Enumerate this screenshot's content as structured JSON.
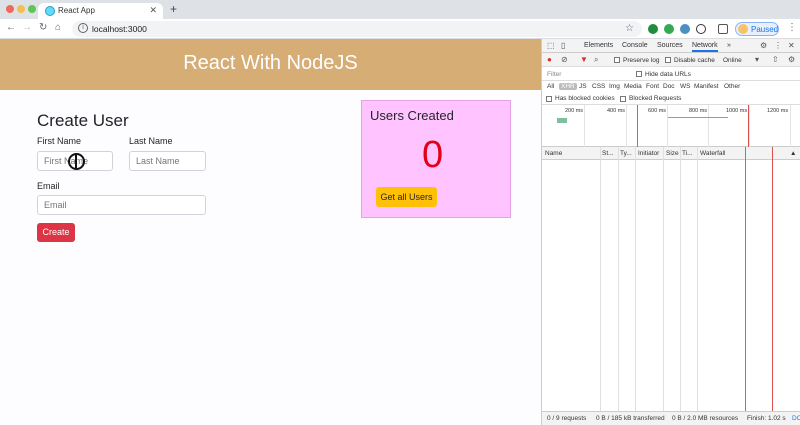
{
  "browser": {
    "tab_title": "React App",
    "url": "localhost:3000",
    "profile_label": "Paused"
  },
  "page": {
    "banner_title": "React With NodeJS",
    "form": {
      "title": "Create User",
      "first_name_label": "First Name",
      "first_name_placeholder": "First Name",
      "last_name_label": "Last Name",
      "last_name_placeholder": "Last Name",
      "email_label": "Email",
      "email_placeholder": "Email",
      "create_button": "Create"
    },
    "users_card": {
      "title": "Users Created",
      "count": "0",
      "get_all_button": "Get all Users"
    }
  },
  "devtools": {
    "tabs": [
      "Elements",
      "Console",
      "Sources",
      "Network"
    ],
    "active_tab": "Network",
    "more_tabs": "»",
    "preserve_log": "Preserve log",
    "disable_cache": "Disable cache",
    "throttle": "Online",
    "filter_placeholder": "Filter",
    "hide_data_urls": "Hide data URLs",
    "types": [
      "All",
      "XHR",
      "JS",
      "CSS",
      "Img",
      "Media",
      "Font",
      "Doc",
      "WS",
      "Manifest",
      "Other"
    ],
    "active_type": "XHR",
    "has_blocked_cookies": "Has blocked cookies",
    "blocked_requests": "Blocked Requests",
    "timeline_ticks": [
      "200 ms",
      "400 ms",
      "600 ms",
      "800 ms",
      "1000 ms",
      "1200 ms"
    ],
    "columns": [
      "Name",
      "St...",
      "Ty...",
      "Initiator",
      "Size",
      "Ti...",
      "Waterfall"
    ],
    "sort_arrow": "▲",
    "status": {
      "requests": "0 / 9 requests",
      "transferred": "0 B / 185 kB transferred",
      "resources": "0 B / 2.0 MB resources",
      "finish": "Finish: 1.02 s",
      "more": "DC"
    }
  },
  "colors": {
    "banner": "#d6ad75",
    "card": "#ffc4ff",
    "count": "#e3001b",
    "create_button": "#dc3545",
    "get_all_button": "#ffc107"
  }
}
